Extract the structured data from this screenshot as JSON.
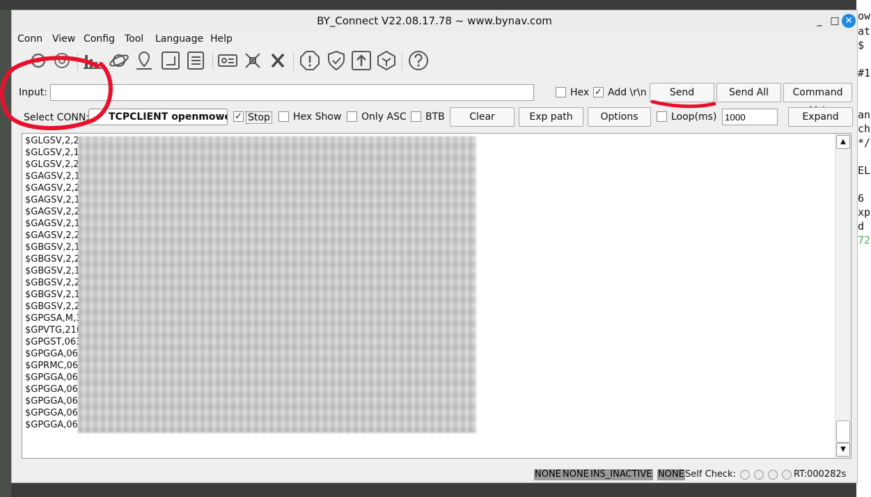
{
  "window": {
    "title": "BY_Connect V22.08.17.78 ~ www.bynav.com",
    "minimize": "_",
    "maximize": "□",
    "close": "✕"
  },
  "menu": [
    "Conn",
    "View",
    "Config",
    "Tool",
    "Language",
    "Help"
  ],
  "toolbar_icons": [
    "gear-icon",
    "satellite-dish-icon",
    "bar-chart-icon",
    "planet-icon",
    "location-pin-icon",
    "route-icon",
    "list-icon",
    "id-card-icon",
    "drone-icon",
    "x-icon",
    "alert-octagon-icon",
    "shield-check-icon",
    "upload-arrow-icon",
    "cube-icon",
    "help-icon"
  ],
  "input": {
    "label": "Input:",
    "value": "",
    "hex_label": "Hex",
    "add_rn_label": "Add \\r\\n",
    "send": "Send",
    "send_all": "Send All",
    "command_list": "Command List"
  },
  "conn": {
    "label": "Select CONN:",
    "selected": "TCPCLIENT openmower",
    "stop_label": "Stop",
    "hex_show_label": "Hex Show",
    "only_asc_label": "Only ASC",
    "btb_label": "BTB",
    "clear": "Clear",
    "exp_path": "Exp path",
    "options": "Options",
    "loop_label": "Loop(ms)",
    "loop_value": "1000",
    "expand": "Expand"
  },
  "log_lines": [
    "$GLGSV,2,2,",
    "$GLGSV,2,1,",
    "$GLGSV,2,2,",
    "$GAGSV,2,1",
    "$GAGSV,2,2",
    "$GAGSV,2,1",
    "$GAGSV,2,2",
    "$GAGSV,2,1",
    "$GAGSV,2,2",
    "$GBGSV,2,1",
    "$GBGSV,2,2",
    "$GBGSV,2,1",
    "$GBGSV,2,2",
    "$GBGSV,2,1",
    "$GBGSV,2,2",
    "$GPGSA,M,3",
    "$GPVTG,216",
    "$GPGST,063",
    "$GPGGA,06.",
    "$GPRMC,063",
    "$GPGGA,06.",
    "$GPGGA,06.",
    "$GPGGA,063",
    "$GPGGA,06.",
    "$GPGGA,06."
  ],
  "status": {
    "tags": [
      "NONE",
      "NONE",
      "INS_INACTIVE",
      "NONE"
    ],
    "self_check": "Self Check:",
    "rt": "RT:000282s"
  },
  "colors": {
    "accent": "#1e88e5",
    "annotation": "#e8112d",
    "status_tag": "#9a9a9a"
  },
  "desktop_right_text": [
    "ow",
    "at",
    "$",
    "",
    "#1",
    "",
    "",
    "an",
    "ch",
    "*/",
    "",
    "EL",
    "",
    "6",
    "xp",
    "d",
    "72"
  ]
}
